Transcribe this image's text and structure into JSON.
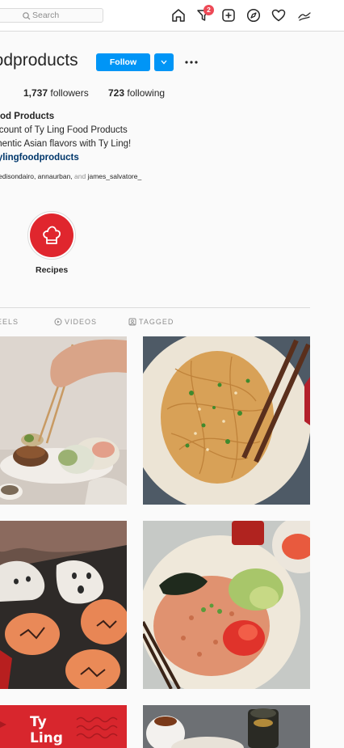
{
  "topbar": {
    "search_placeholder": "Search",
    "notification_count": "2",
    "icons": [
      "home-icon",
      "activity-icon",
      "new-post-icon",
      "explore-icon",
      "heart-icon",
      "profile-icon"
    ]
  },
  "profile": {
    "username": "oodproducts",
    "follow_label": "Follow",
    "followers_count": "1,737",
    "followers_label": " followers",
    "following_count": "723",
    "following_label": " following",
    "bio": {
      "name": "ood Products",
      "line1": "ccount of Ty Ling Food Products",
      "line2": "thentic Asian flavors with Ty Ling!",
      "link": "tylingfoodproducts"
    },
    "followed_by": {
      "users": "edisondairo, annaurban,",
      "and": " and ",
      "last_user": "james_salvatore_"
    }
  },
  "highlights": [
    {
      "label": "Recipes",
      "icon": "chef-hat-icon"
    }
  ],
  "tabs": [
    {
      "label": "EELS",
      "icon": "reels-icon"
    },
    {
      "label": "VIDEOS",
      "icon": "video-icon"
    },
    {
      "label": "TAGGED",
      "icon": "tagged-icon"
    }
  ],
  "posts": [
    {
      "subject": "spring-rolls-with-chopsticks"
    },
    {
      "subject": "sesame-noodles-with-chopsticks"
    },
    {
      "subject": "halloween-rice-cakes"
    },
    {
      "subject": "kimchi-fried-rice-with-avocado"
    },
    {
      "subject": "ty-ling-red-logo-post",
      "logo_text": "Ty Ling"
    },
    {
      "subject": "sauce-jars-and-bowl"
    }
  ],
  "colors": {
    "accent": "#0095f6",
    "brand_red": "#e0262e",
    "badge": "#ed4956",
    "link": "#00376b"
  }
}
